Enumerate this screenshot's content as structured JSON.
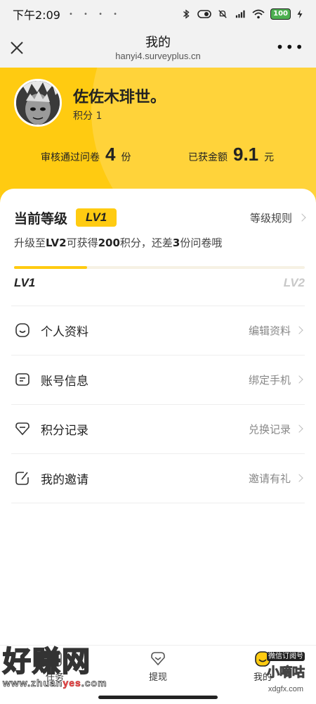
{
  "status_bar": {
    "time": "下午2:09",
    "notification_icons": "• • • •",
    "battery": "100",
    "icons": [
      "bluetooth-icon",
      "toggle-icon",
      "mute-icon",
      "hd-signal-icon",
      "wifi-icon",
      "battery-icon",
      "charging-icon"
    ]
  },
  "header": {
    "title": "我的",
    "url": "hanyi4.surveyplus.cn"
  },
  "profile": {
    "username": "佐佐木琲世。",
    "points_label": "积分 1",
    "approved_label": "审核通过问卷",
    "approved_count": "4",
    "approved_unit": "份",
    "earned_label": "已获金额",
    "earned_amount": "9.1",
    "earned_unit": "元"
  },
  "level": {
    "title": "当前等级",
    "badge": "LV1",
    "rules_label": "等级规则",
    "upgrade_text": {
      "p1": "升级至",
      "b1": "LV2",
      "p2": "可获得",
      "b2": "200",
      "p3": "积分，还差",
      "b3": "3",
      "p4": "份问卷哦"
    },
    "progress_fraction": 0.25,
    "current_label": "LV1",
    "next_label": "LV2"
  },
  "menu": [
    {
      "label": "个人资料",
      "action": "编辑资料",
      "icon": "profile-icon"
    },
    {
      "label": "账号信息",
      "action": "绑定手机",
      "icon": "account-card-icon"
    },
    {
      "label": "积分记录",
      "action": "兑换记录",
      "icon": "points-tag-icon"
    },
    {
      "label": "我的邀请",
      "action": "邀请有礼",
      "icon": "invite-icon"
    }
  ],
  "tabbar": {
    "tabs": [
      {
        "label": "任务",
        "icon": "task-icon"
      },
      {
        "label": "提现",
        "icon": "withdraw-icon"
      },
      {
        "label": "我的",
        "icon": "me-icon"
      }
    ]
  },
  "watermarks": {
    "left_big": "好赚网",
    "left_small_a": "www.zhuan",
    "left_small_b": "yes",
    "left_small_c": ".com",
    "right_top": "微信订阅号",
    "right_mid": "小嘀咕",
    "right_bottom": "xdgfx.com"
  },
  "colors": {
    "accent": "#ffcb11",
    "accent_light": "#ffd33a",
    "text": "#222222",
    "muted": "#888888"
  }
}
